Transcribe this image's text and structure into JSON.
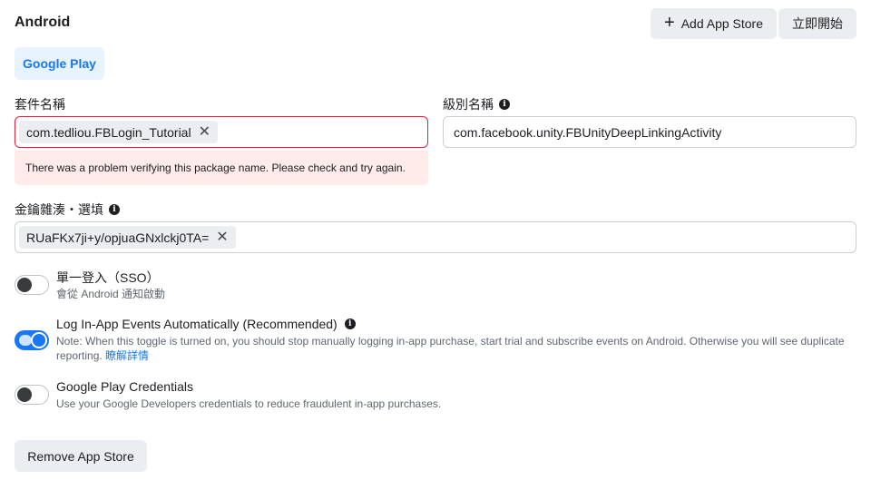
{
  "section": {
    "title": "Android"
  },
  "actions": {
    "add_store_label": "Add App Store",
    "start_label": "立即開始"
  },
  "platform_tab": {
    "label": "Google Play"
  },
  "package_name": {
    "label": "套件名稱",
    "token": "com.tedliou.FBLogin_Tutorial",
    "error": "There was a problem verifying this package name. Please check and try again."
  },
  "class_name": {
    "label": "級別名稱",
    "value": "com.facebook.unity.FBUnityDeepLinkingActivity"
  },
  "key_hash": {
    "label": "金鑰雜湊・選填",
    "token": "RUaFKx7ji+y/opjuaGNxlckj0TA="
  },
  "options": [
    {
      "title": "單一登入（SSO）",
      "desc": "會從 Android 通知啟動",
      "on": false
    },
    {
      "title": "Log In-App Events Automatically (Recommended)",
      "desc": "Note: When this toggle is turned on, you should stop manually logging in-app purchase, start trial and subscribe events on Android. Otherwise you will see duplicate reporting.",
      "link": "瞭解詳情",
      "on": true
    },
    {
      "title": "Google Play Credentials",
      "desc": "Use your Google Developers credentials to reduce fraudulent in-app purchases.",
      "on": false
    }
  ],
  "remove_label": "Remove App Store",
  "colors": {
    "accent": "#1877f2",
    "error_border": "#e41e3f",
    "error_bg": "#ffebe9"
  }
}
